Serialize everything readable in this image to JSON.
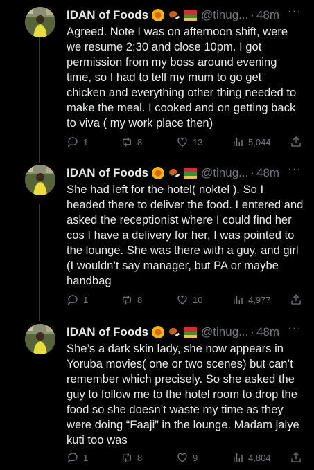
{
  "tweets": [
    {
      "name": "IDAN of Foods",
      "handle": "@tinug...",
      "sep": "·",
      "time": "48m",
      "more": "···",
      "text": "Agreed. Note I was on afternoon shift, were we resume 2:30 and close 10pm. I got permission from my boss around evening time, so I had to tell my mum to go get chicken and everything other thing needed to make the meal. I cooked and on getting back to viva ( my work place then)",
      "replies": "1",
      "retweets": "8",
      "likes": "13",
      "views": "5,044"
    },
    {
      "name": "IDAN of Foods",
      "handle": "@tinug...",
      "sep": "·",
      "time": "48m",
      "more": "···",
      "text": "She had left for the hotel( noktel ). So I headed there to deliver the food. I entered and asked the receptionist where I could find her cos I have a delivery for her, I was pointed to the lounge. She was there with a guy, and girl (I wouldn’t say manager, but PA or maybe handbag",
      "replies": "1",
      "retweets": "8",
      "likes": "10",
      "views": "4,977"
    },
    {
      "name": "IDAN of Foods",
      "handle": "@tinug...",
      "sep": "·",
      "time": "48m",
      "more": "···",
      "text": "She’s a dark skin lady, she now appears in Yoruba movies( one or two scenes) but can’t remember which precisely. So she asked the guy to follow me to the hotel room to drop the food so she doesn’t waste my time as they were doing “Faaji” in the lounge. Madam jaiye kuti too was",
      "replies": "1",
      "retweets": "8",
      "likes": "9",
      "views": "4,804"
    }
  ],
  "icons": {
    "name_emojis": [
      "orange-slice-emoji-icon",
      "drumstick-emoji-icon",
      "bento-box-emoji-icon"
    ],
    "actions": [
      "reply-icon",
      "retweet-icon",
      "like-icon",
      "views-icon",
      "share-icon"
    ]
  },
  "colors": {
    "background": "#000000",
    "text": "#e7e9ea",
    "muted": "#71767b",
    "thread_line": "#333639"
  }
}
